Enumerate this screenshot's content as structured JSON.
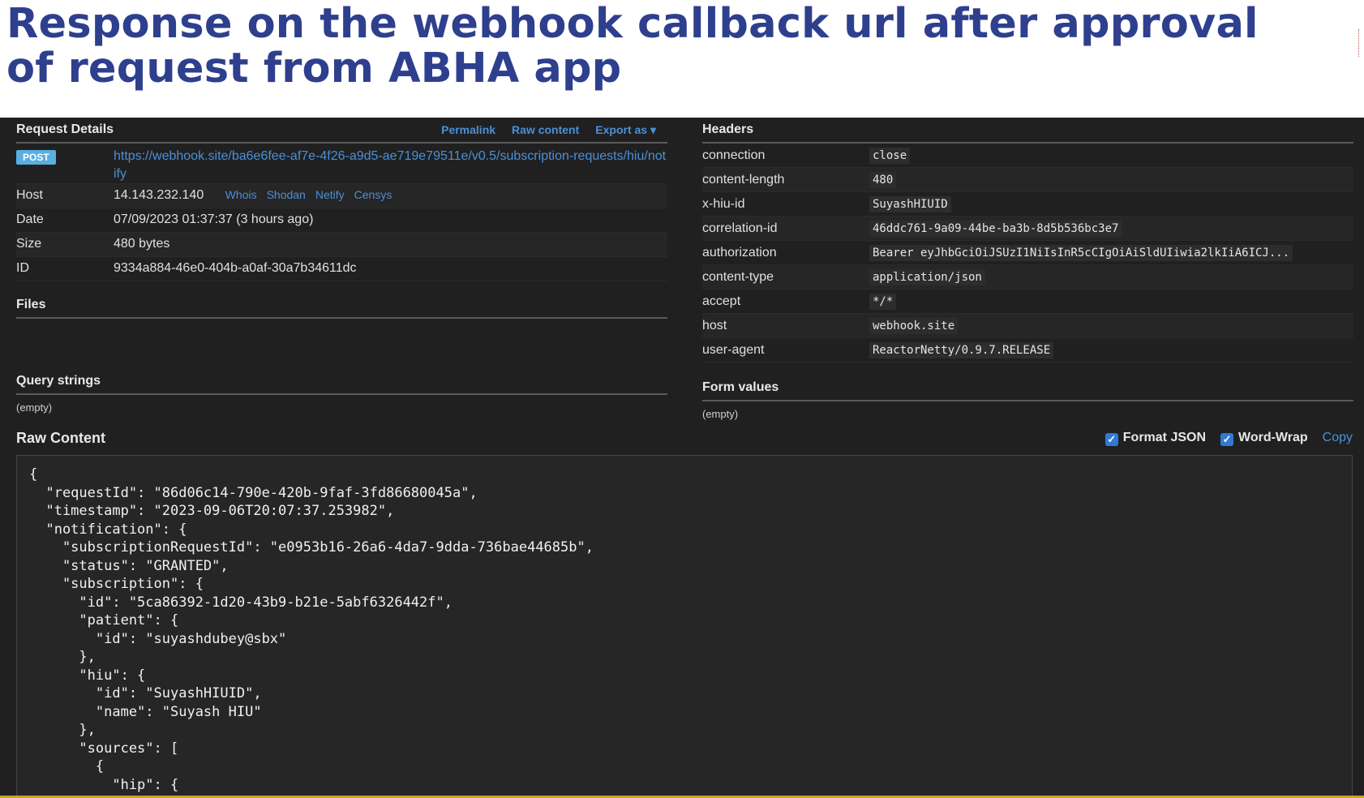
{
  "slide": {
    "title": "Response on the webhook callback url after approval of request from ABHA app"
  },
  "request_details": {
    "title": "Request Details",
    "links": [
      "Permalink",
      "Raw content",
      "Export as ▾"
    ],
    "method": "POST",
    "url": "https://webhook.site/ba6e6fee-af7e-4f26-a9d5-ae719e79511e/v0.5/subscription-requests/hiu/notify",
    "host_label": "Host",
    "host_value": "14.143.232.140",
    "host_links": [
      "Whois",
      "Shodan",
      "Netify",
      "Censys"
    ],
    "date_label": "Date",
    "date_value": "07/09/2023 01:37:37 (3 hours ago)",
    "size_label": "Size",
    "size_value": "480 bytes",
    "id_label": "ID",
    "id_value": "9334a884-46e0-404b-a0af-30a7b34611dc"
  },
  "files": {
    "title": "Files"
  },
  "query_strings": {
    "title": "Query strings",
    "value": "(empty)"
  },
  "headers": {
    "title": "Headers",
    "rows": [
      {
        "k": "connection",
        "v": "close"
      },
      {
        "k": "content-length",
        "v": "480"
      },
      {
        "k": "x-hiu-id",
        "v": "SuyashHIUID"
      },
      {
        "k": "correlation-id",
        "v": "46ddc761-9a09-44be-ba3b-8d5b536bc3e7"
      },
      {
        "k": "authorization",
        "v": "Bearer eyJhbGciOiJSUzI1NiIsInR5cCIgOiAiSldUIiwia2lkIiA6ICJ..."
      },
      {
        "k": "content-type",
        "v": "application/json"
      },
      {
        "k": "accept",
        "v": "*/*"
      },
      {
        "k": "host",
        "v": "webhook.site"
      },
      {
        "k": "user-agent",
        "v": "ReactorNetty/0.9.7.RELEASE"
      }
    ]
  },
  "form_values": {
    "title": "Form values",
    "value": "(empty)"
  },
  "raw_content": {
    "title": "Raw Content",
    "format_json": "Format JSON",
    "word_wrap": "Word-Wrap",
    "copy": "Copy",
    "lines": [
      "{",
      "  \"requestId\": \"86d06c14-790e-420b-9faf-3fd86680045a\",",
      "  \"timestamp\": \"2023-09-06T20:07:37.253982\",",
      "  \"notification\": {",
      "    \"subscriptionRequestId\": \"e0953b16-26a6-4da7-9dda-736bae44685b\",",
      "    \"status\": \"GRANTED\",",
      "    \"subscription\": {",
      "      \"id\": \"5ca86392-1d20-43b9-b21e-5abf6326442f\",",
      "      \"patient\": {",
      "        \"id\": \"suyashdubey@sbx\"",
      "      },",
      "      \"hiu\": {",
      "        \"id\": \"SuyashHIUID\",",
      "        \"name\": \"Suyash HIU\"",
      "      },",
      "      \"sources\": [",
      "        {",
      "          \"hip\": {"
    ]
  }
}
